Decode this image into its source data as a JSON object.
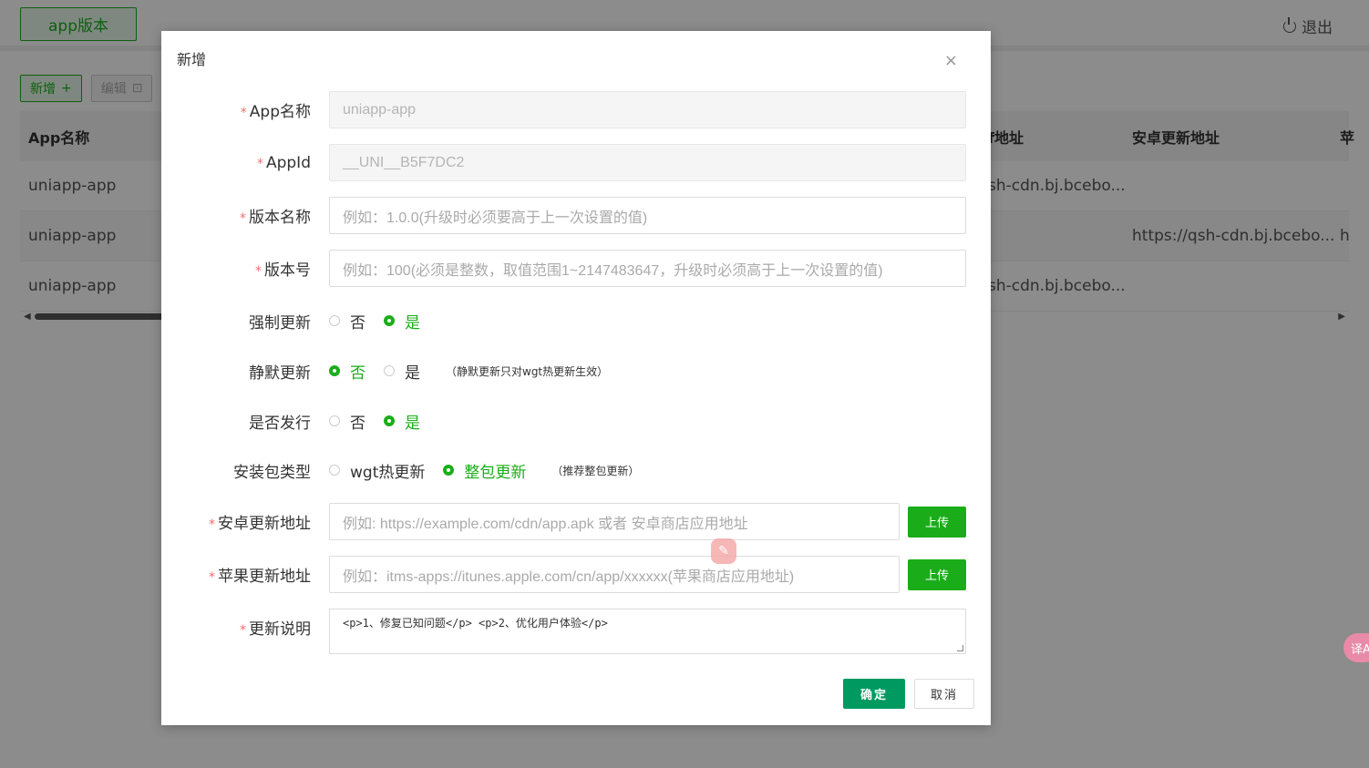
{
  "header": {
    "brand": "app版本",
    "logout": "退出"
  },
  "toolbar": {
    "add": "新增",
    "add_icon": "+",
    "edit": "编辑",
    "edit_icon": "⊡"
  },
  "table": {
    "headers": [
      "App名称",
      "f地址",
      "安卓更新地址",
      "苹"
    ],
    "rows": [
      {
        "name": "uniapp-app",
        "colA": "sh-cdn.bj.bcebo...",
        "colB": "",
        "colC": ""
      },
      {
        "name": "uniapp-app",
        "colA": "",
        "colB": "https://qsh-cdn.bj.bcebo...",
        "colC": "h"
      },
      {
        "name": "uniapp-app",
        "colA": "sh-cdn.bj.bcebo...",
        "colB": "",
        "colC": ""
      }
    ]
  },
  "modal": {
    "title": "新增",
    "close": "×",
    "fields": {
      "app_name": {
        "label": "App名称",
        "value": "uniapp-app"
      },
      "app_id": {
        "label": "AppId",
        "value": "__UNI__B5F7DC2"
      },
      "version_name": {
        "label": "版本名称",
        "placeholder": "例如：1.0.0(升级时必须要高于上一次设置的值)"
      },
      "version_code": {
        "label": "版本号",
        "placeholder": "例如：100(必须是整数，取值范围1~2147483647，升级时必须高于上一次设置的值)"
      },
      "force_update": {
        "label": "强制更新",
        "options": [
          "否",
          "是"
        ],
        "selected": "是"
      },
      "silent_update": {
        "label": "静默更新",
        "options": [
          "否",
          "是"
        ],
        "selected": "否",
        "hint": "（静默更新只对wgt热更新生效）"
      },
      "publish": {
        "label": "是否发行",
        "options": [
          "否",
          "是"
        ],
        "selected": "是"
      },
      "package_type": {
        "label": "安装包类型",
        "options": [
          "wgt热更新",
          "整包更新"
        ],
        "selected": "整包更新",
        "hint": "（推荐整包更新）"
      },
      "android_url": {
        "label": "安卓更新地址",
        "placeholder": "例如: https://example.com/cdn/app.apk 或者 安卓商店应用地址",
        "upload": "上传"
      },
      "ios_url": {
        "label": "苹果更新地址",
        "placeholder": "例如：itms-apps://itunes.apple.com/cn/app/xxxxxx(苹果商店应用地址)",
        "upload": "上传"
      },
      "description": {
        "label": "更新说明",
        "value": "<p>1、修复已知问题</p> <p>2、优化用户体验</p>"
      }
    },
    "ok": "确定",
    "cancel": "取消"
  },
  "float_side": "译A",
  "colors": {
    "accent": "#1aad19",
    "confirm": "#009a61",
    "required": "#f56c6c"
  }
}
